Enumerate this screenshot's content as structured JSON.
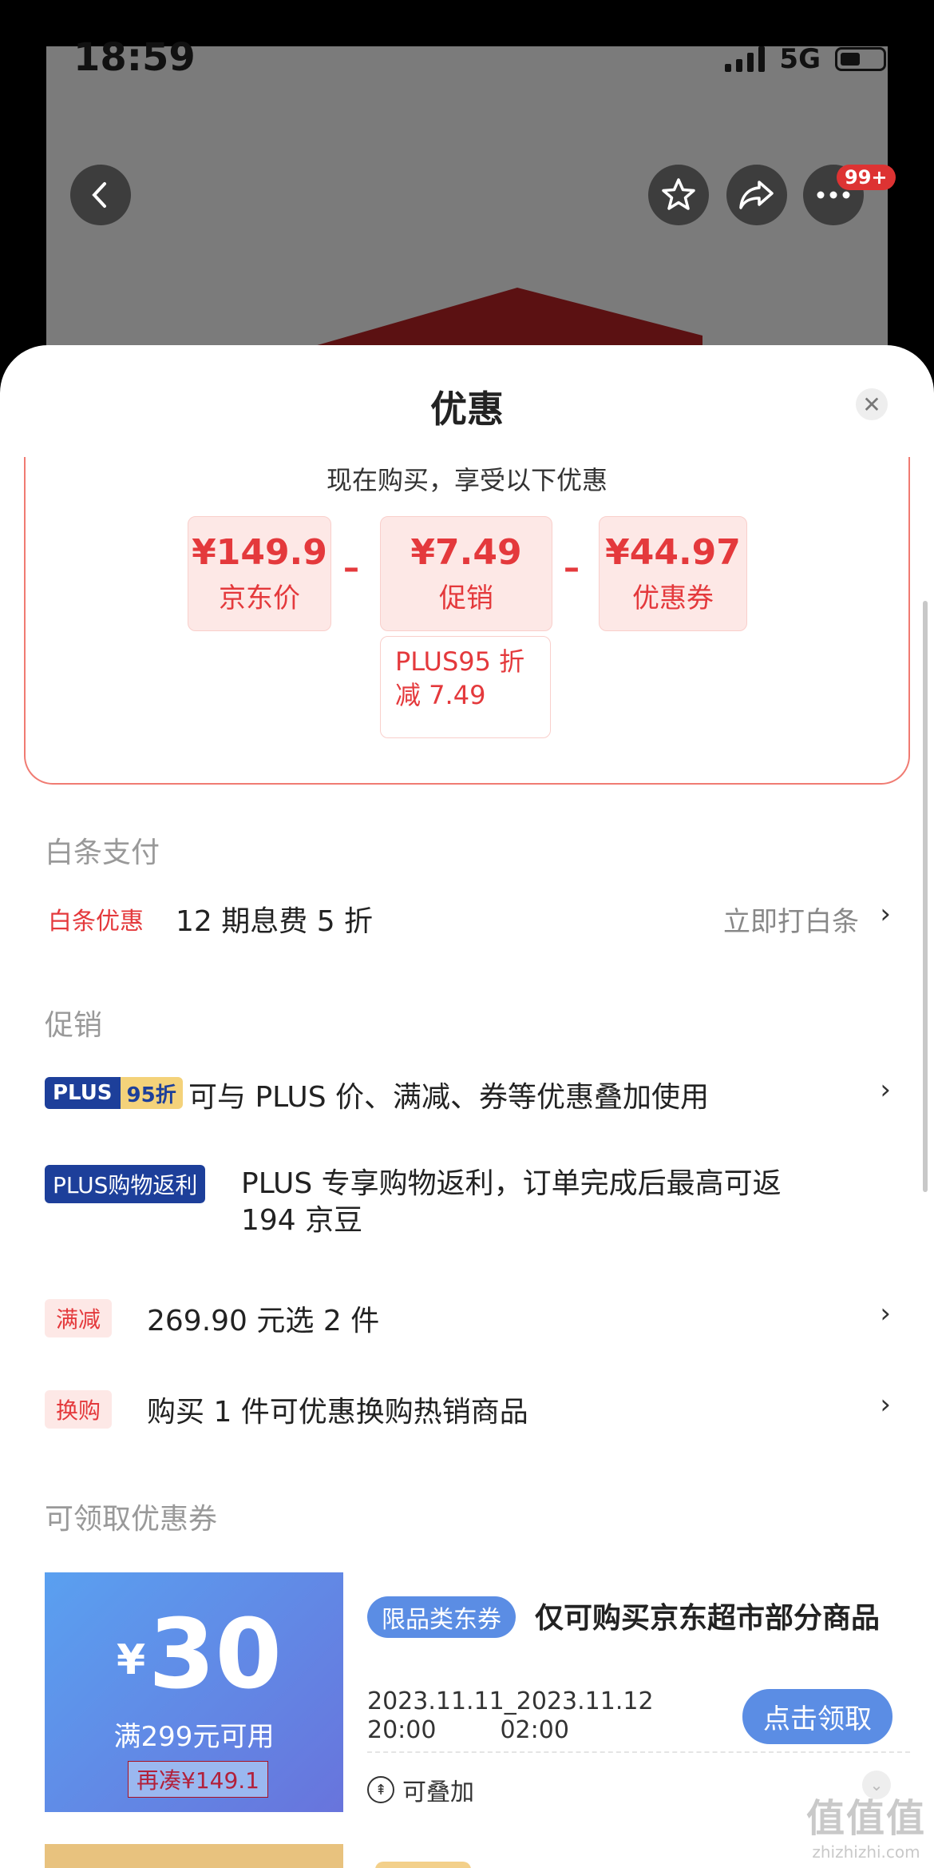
{
  "status_bar": {
    "time": "18:59",
    "network": "5G"
  },
  "top_nav": {
    "badge": "99+"
  },
  "sheet": {
    "title": "优惠",
    "summary": {
      "heading": "现在购买，享受以下优惠",
      "prices": [
        {
          "value": "¥149.9",
          "label": "京东价"
        },
        {
          "value": "¥7.49",
          "label": "促销"
        },
        {
          "value": "¥44.97",
          "label": "优惠券"
        }
      ],
      "operator": "–",
      "promo_detail_line1": "PLUS95 折",
      "promo_detail_line2": "减 7.49"
    },
    "baitiao": {
      "section_title": "白条支付",
      "tag": "白条优惠",
      "text": "12 期息费 5 折",
      "action": "立即打白条"
    },
    "promotions": {
      "section_title": "促销",
      "items": [
        {
          "tag_a": "PLUS",
          "tag_b": "95折",
          "text": "可与 PLUS 价、满减、券等优惠叠加使用"
        },
        {
          "tag": "PLUS购物返利",
          "text_line1": "PLUS 专享购物返利，订单完成后最高可返",
          "text_line2": "194 京豆"
        },
        {
          "tag": "满减",
          "text": "269.90 元选 2 件"
        },
        {
          "tag": "换购",
          "text": "购买 1 件可优惠换购热销商品"
        }
      ],
      "chevron": "›"
    },
    "coupons": {
      "section_title": "可领取优惠券",
      "items": [
        {
          "currency": "¥",
          "amount": "30",
          "condition": "满299元可用",
          "gap_note": "再凑¥149.1",
          "type_tag": "限品类东券",
          "description": "仅可购买京东超市部分商品",
          "start_date": "2023.11.11",
          "start_time": "20:00",
          "end_date": "2023.11.12",
          "end_time": "02:00",
          "separator": "_",
          "button": "点击领取",
          "stackable": "可叠加"
        }
      ]
    }
  },
  "watermark": {
    "logo": "值值值",
    "site": "zhizhizhi.com"
  },
  "colors": {
    "accent_red": "#e4393c",
    "plus_blue": "#1d3f9a",
    "coupon_blue": "#5b8de4"
  }
}
